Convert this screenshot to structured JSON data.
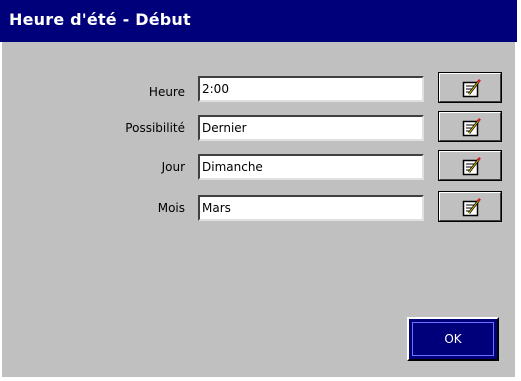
{
  "window": {
    "title": "Heure d'été - Début"
  },
  "fields": [
    {
      "label": "Heure",
      "value": "2:00"
    },
    {
      "label": "Possibilité",
      "value": "Dernier"
    },
    {
      "label": "Jour",
      "value": "Dimanche"
    },
    {
      "label": "Mois",
      "value": "Mars"
    }
  ],
  "buttons": {
    "ok_label": "OK",
    "edit_icon": "edit-notepad-icon"
  },
  "colors": {
    "titlebar": "#00007b",
    "dialog_bg": "#c0c0c0",
    "ok_button": "#00007b"
  }
}
